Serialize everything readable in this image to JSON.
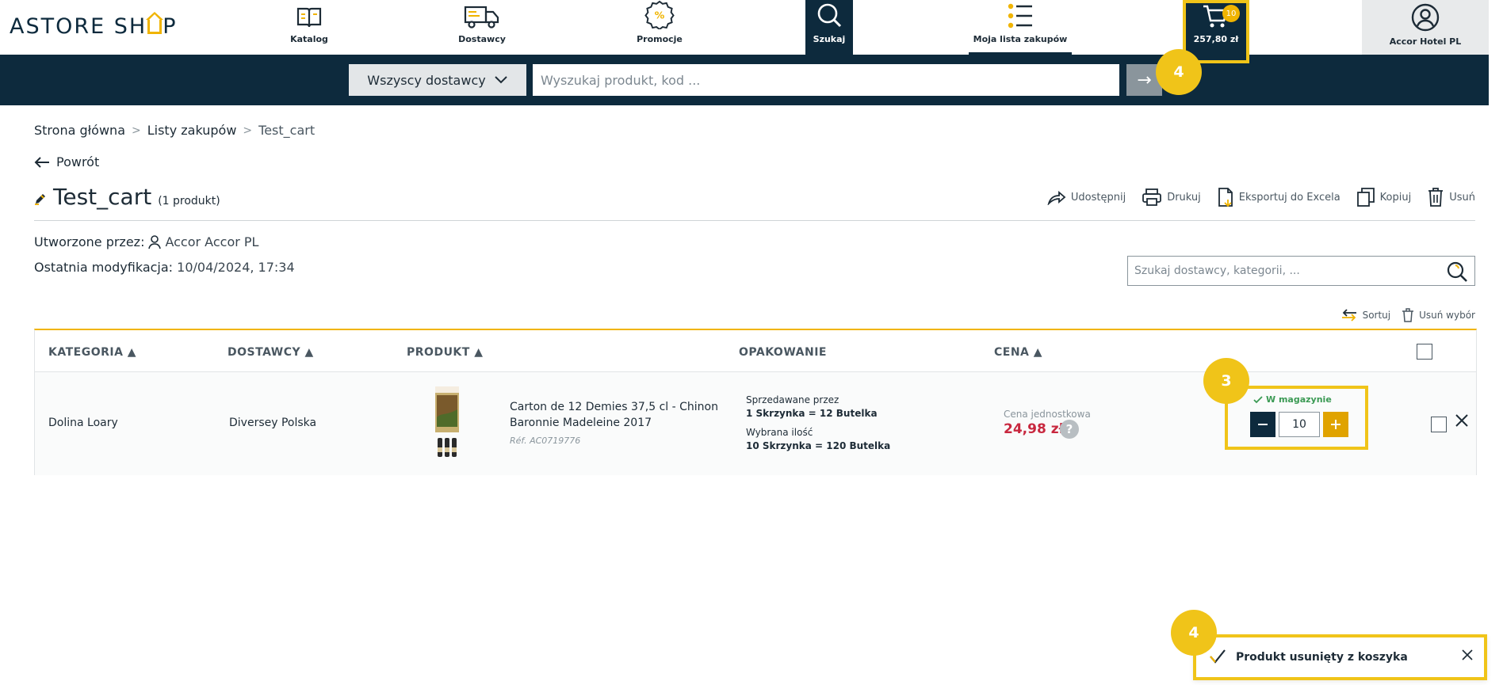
{
  "brand": {
    "logo_left": "ASTORE SH",
    "logo_right": "P"
  },
  "nav": {
    "katalog": "Katalog",
    "dostawcy": "Dostawcy",
    "promocje": "Promocje",
    "szukaj": "Szukaj",
    "lista": "Moja lista zakupów",
    "cart_total": "257,80 zł",
    "cart_count": "10",
    "account": "Accor Hotel PL"
  },
  "search": {
    "supplier_select": "Wszyscy dostawcy",
    "placeholder": "Wyszukaj produkt, kod ...",
    "go": "→"
  },
  "badges": {
    "search_badge": "4",
    "qty_badge": "3",
    "toast_badge": "4"
  },
  "breadcrumb": {
    "home": "Strona główna",
    "lists": "Listy zakupów",
    "current": "Test_cart",
    "sep": ">"
  },
  "back": "Powrót",
  "title": {
    "name": "Test_cart",
    "count": "(1 produkt)"
  },
  "actions": {
    "share": "Udostępnij",
    "print": "Drukuj",
    "export": "Eksportuj do Excela",
    "copy": "Kopiuj",
    "delete": "Usuń"
  },
  "meta": {
    "created_label": "Utworzone przez:",
    "created_value": "Accor Accor PL",
    "modified_label": "Ostatnia modyfikacja:",
    "modified_value": "10/04/2024, 17:34"
  },
  "filter": {
    "placeholder": "Szukaj dostawcy, kategorii, ..."
  },
  "list_tools": {
    "sort": "Sortuj",
    "remove_selection": "Usuń wybór"
  },
  "table": {
    "headers": {
      "category": "KATEGORIA ▲",
      "supplier": "DOSTAWCY ▲",
      "product": "PRODUKT ▲",
      "packaging": "OPAKOWANIE",
      "price": "CENA ▲"
    },
    "rows": [
      {
        "category": "Dolina Loary",
        "supplier": "Diversey Polska",
        "product_name": "Carton de 12 Demies 37,5 cl - Chinon Baronnie Madeleine 2017",
        "product_ref": "Réf. AC0719776",
        "sold_by_label": "Sprzedawane przez",
        "sold_by_value": "1 Skrzynka = 12 Butelka",
        "chosen_label": "Wybrana ilość",
        "chosen_value": "10 Skrzynka = 120 Butelka",
        "unit_price_label": "Cena jednostkowa",
        "unit_price": "24,98 zł",
        "stock": "W magazynie",
        "quantity": "10"
      }
    ]
  },
  "toast": {
    "message": "Produkt usunięty z koszyka"
  },
  "colors": {
    "navy": "#0d2a3d",
    "accent": "#f0b400",
    "highlight": "#f0c419",
    "price": "#c8283f",
    "stock": "#3b9a54"
  }
}
